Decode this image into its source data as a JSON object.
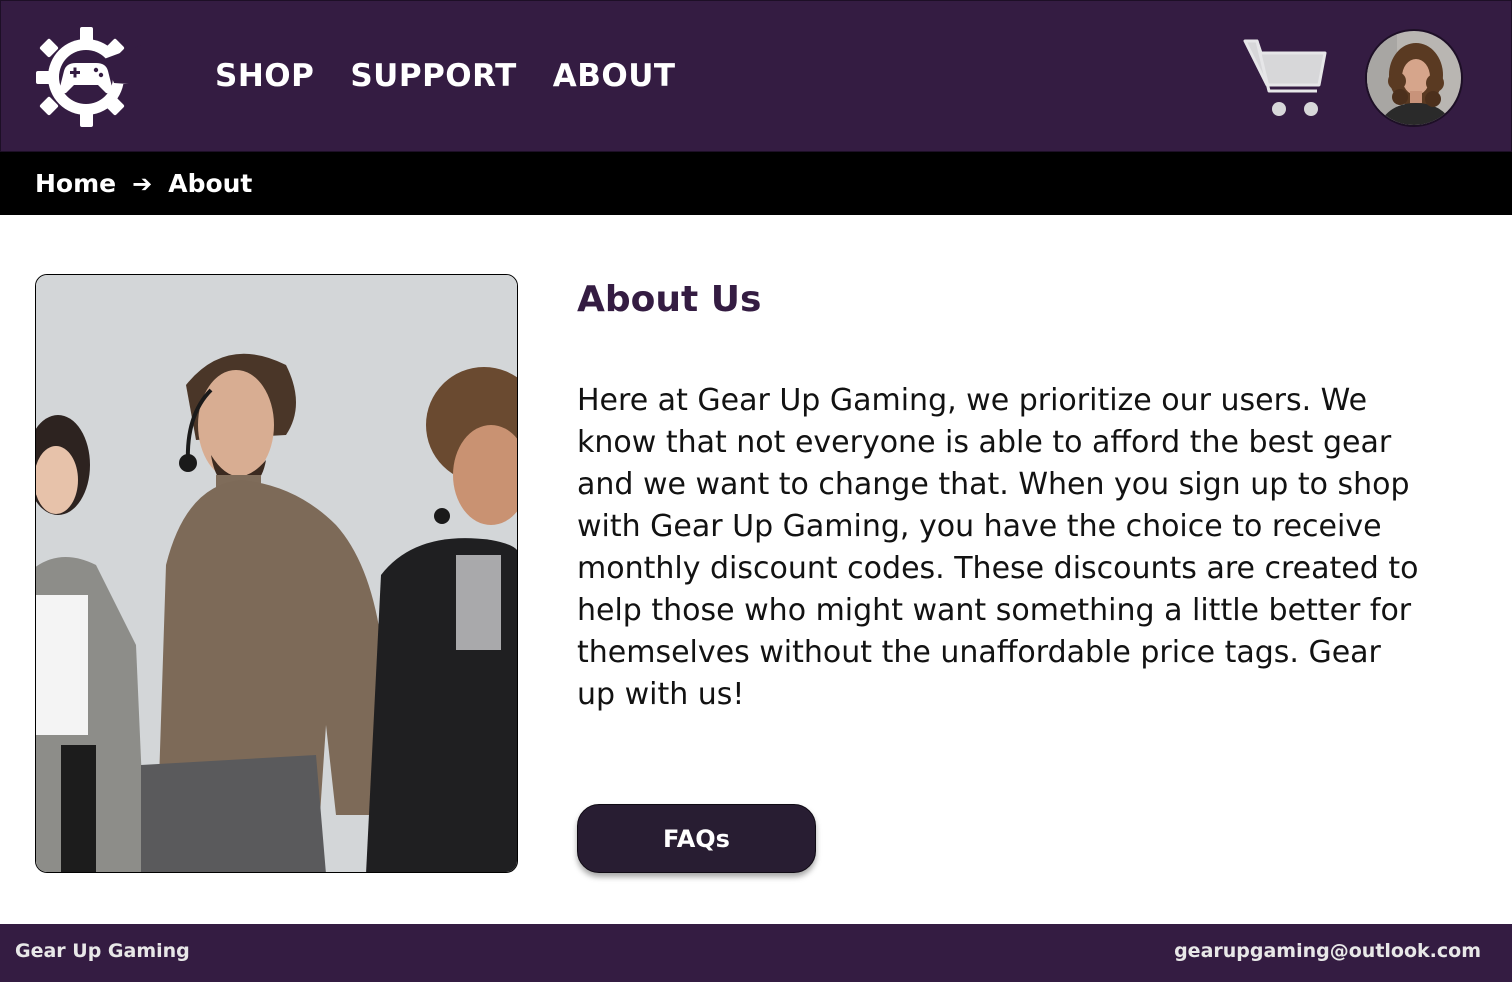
{
  "header": {
    "logo_icon": "gear-gamepad-icon",
    "nav": [
      {
        "label": "SHOP"
      },
      {
        "label": "SUPPORT"
      },
      {
        "label": "ABOUT"
      }
    ],
    "cart_icon": "shopping-cart-icon",
    "avatar_alt": "user-avatar"
  },
  "breadcrumb": {
    "home": "Home",
    "separator": "➔",
    "current": "About"
  },
  "main": {
    "image": "team-photo",
    "title": "About Us",
    "body": "Here at Gear Up Gaming, we prioritize our users. We know that not everyone is able to afford the best gear and we want to change that. When you sign up to shop with Gear Up Gaming, you have the choice to receive monthly discount codes. These discounts are created to help those who might want something a little better for themselves without the unaffordable price tags. Gear up with us!",
    "button_label": "FAQs"
  },
  "footer": {
    "brand": "Gear Up Gaming",
    "email": "gearupgaming@outlook.com"
  },
  "colors": {
    "brand_purple": "#341c42",
    "breadcrumb_bg": "#000000",
    "button_bg": "#281d32",
    "text": "#121212"
  }
}
